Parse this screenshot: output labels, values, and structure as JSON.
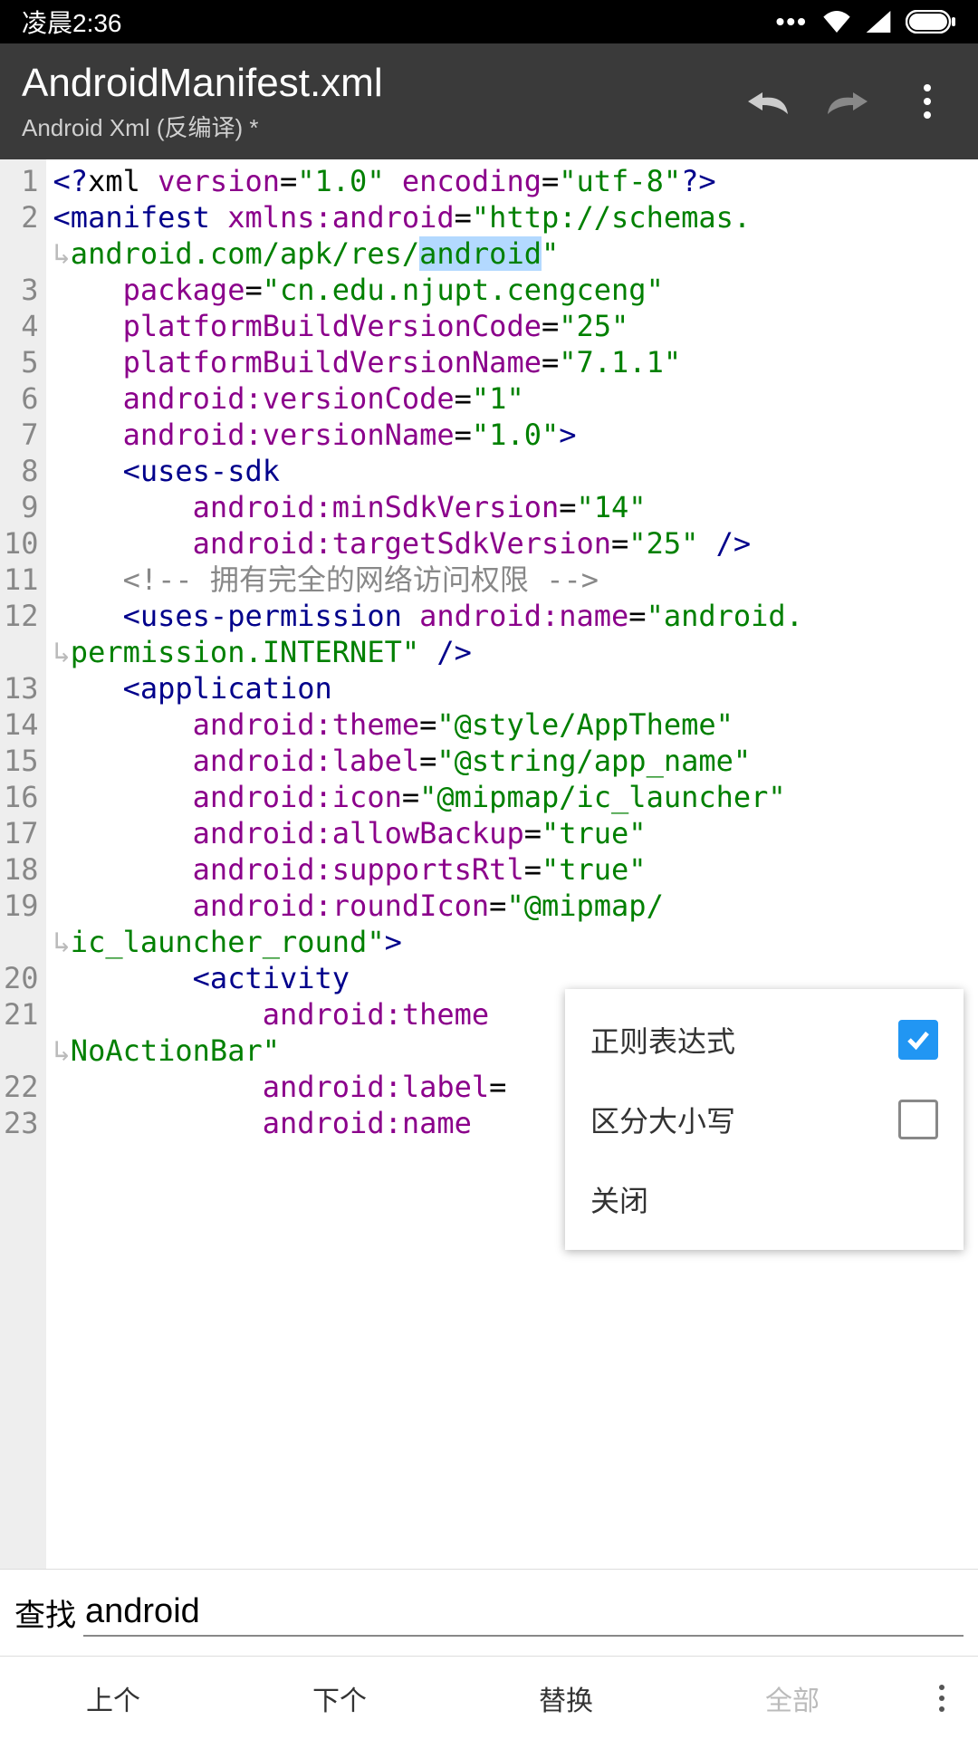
{
  "status": {
    "time": "凌晨2:36",
    "dots": "•••"
  },
  "appbar": {
    "title": "AndroidManifest.xml",
    "subtitle": "Android Xml (反编译) *"
  },
  "code": {
    "lines": [
      {
        "n": "1",
        "seg": [
          {
            "t": "<?",
            "c": "tag"
          },
          {
            "t": "xml ",
            "c": ""
          },
          {
            "t": "version",
            "c": "attr"
          },
          {
            "t": "=",
            "c": ""
          },
          {
            "t": "\"1.0\"",
            "c": "str"
          },
          {
            "t": " ",
            "c": ""
          },
          {
            "t": "encoding",
            "c": "attr"
          },
          {
            "t": "=",
            "c": ""
          },
          {
            "t": "\"utf-8\"",
            "c": "str"
          },
          {
            "t": "?>",
            "c": "tag"
          }
        ]
      },
      {
        "n": "2",
        "seg": [
          {
            "t": "<",
            "c": "tag"
          },
          {
            "t": "manifest ",
            "c": "tag"
          },
          {
            "t": "xmlns:android",
            "c": "ns"
          },
          {
            "t": "=",
            "c": ""
          },
          {
            "t": "\"http://schemas.",
            "c": "str"
          }
        ]
      },
      {
        "n": "",
        "wrap": true,
        "seg": [
          {
            "t": "↳",
            "c": "wrap-arrow"
          },
          {
            "t": "android.com/apk/res/",
            "c": "str"
          },
          {
            "t": "android",
            "c": "str",
            "sel": true
          },
          {
            "t": "\"",
            "c": "str"
          }
        ]
      },
      {
        "n": "3",
        "seg": [
          {
            "t": "    ",
            "c": ""
          },
          {
            "t": "package",
            "c": "attr"
          },
          {
            "t": "=",
            "c": ""
          },
          {
            "t": "\"cn.edu.njupt.cengceng\"",
            "c": "str"
          }
        ]
      },
      {
        "n": "4",
        "seg": [
          {
            "t": "    ",
            "c": ""
          },
          {
            "t": "platformBuildVersionCode",
            "c": "attr"
          },
          {
            "t": "=",
            "c": ""
          },
          {
            "t": "\"25\"",
            "c": "str"
          }
        ]
      },
      {
        "n": "5",
        "seg": [
          {
            "t": "    ",
            "c": ""
          },
          {
            "t": "platformBuildVersionName",
            "c": "attr"
          },
          {
            "t": "=",
            "c": ""
          },
          {
            "t": "\"7.1.1\"",
            "c": "str"
          }
        ]
      },
      {
        "n": "6",
        "seg": [
          {
            "t": "    ",
            "c": ""
          },
          {
            "t": "android:",
            "c": "ns"
          },
          {
            "t": "versionCode",
            "c": "attr"
          },
          {
            "t": "=",
            "c": ""
          },
          {
            "t": "\"1\"",
            "c": "str"
          }
        ]
      },
      {
        "n": "7",
        "seg": [
          {
            "t": "    ",
            "c": ""
          },
          {
            "t": "android:",
            "c": "ns"
          },
          {
            "t": "versionName",
            "c": "attr"
          },
          {
            "t": "=",
            "c": ""
          },
          {
            "t": "\"1.0\"",
            "c": "str"
          },
          {
            "t": ">",
            "c": "tag"
          }
        ]
      },
      {
        "n": "8",
        "seg": [
          {
            "t": "    ",
            "c": ""
          },
          {
            "t": "<",
            "c": "tag"
          },
          {
            "t": "uses-sdk",
            "c": "tag"
          }
        ]
      },
      {
        "n": "9",
        "seg": [
          {
            "t": "        ",
            "c": ""
          },
          {
            "t": "android:",
            "c": "ns"
          },
          {
            "t": "minSdkVersion",
            "c": "attr"
          },
          {
            "t": "=",
            "c": ""
          },
          {
            "t": "\"14\"",
            "c": "str"
          }
        ]
      },
      {
        "n": "10",
        "seg": [
          {
            "t": "        ",
            "c": ""
          },
          {
            "t": "android:",
            "c": "ns"
          },
          {
            "t": "targetSdkVersion",
            "c": "attr"
          },
          {
            "t": "=",
            "c": ""
          },
          {
            "t": "\"25\"",
            "c": "str"
          },
          {
            "t": " />",
            "c": "tag"
          }
        ]
      },
      {
        "n": "11",
        "seg": [
          {
            "t": "    ",
            "c": ""
          },
          {
            "t": "<!-- 拥有完全的网络访问权限 -->",
            "c": "cmt"
          }
        ]
      },
      {
        "n": "12",
        "seg": [
          {
            "t": "    ",
            "c": ""
          },
          {
            "t": "<",
            "c": "tag"
          },
          {
            "t": "uses-permission ",
            "c": "tag"
          },
          {
            "t": "android:",
            "c": "ns"
          },
          {
            "t": "name",
            "c": "attr"
          },
          {
            "t": "=",
            "c": ""
          },
          {
            "t": "\"android.",
            "c": "str"
          }
        ]
      },
      {
        "n": "",
        "wrap": true,
        "seg": [
          {
            "t": "↳",
            "c": "wrap-arrow"
          },
          {
            "t": "permission.INTERNET\"",
            "c": "str"
          },
          {
            "t": " />",
            "c": "tag"
          }
        ]
      },
      {
        "n": "13",
        "seg": [
          {
            "t": "    ",
            "c": ""
          },
          {
            "t": "<",
            "c": "tag"
          },
          {
            "t": "application",
            "c": "tag"
          }
        ]
      },
      {
        "n": "14",
        "seg": [
          {
            "t": "        ",
            "c": ""
          },
          {
            "t": "android:",
            "c": "ns"
          },
          {
            "t": "theme",
            "c": "attr"
          },
          {
            "t": "=",
            "c": ""
          },
          {
            "t": "\"@style/AppTheme\"",
            "c": "str"
          }
        ]
      },
      {
        "n": "15",
        "seg": [
          {
            "t": "        ",
            "c": ""
          },
          {
            "t": "android:",
            "c": "ns"
          },
          {
            "t": "label",
            "c": "attr"
          },
          {
            "t": "=",
            "c": ""
          },
          {
            "t": "\"@string/app_name\"",
            "c": "str"
          }
        ]
      },
      {
        "n": "16",
        "seg": [
          {
            "t": "        ",
            "c": ""
          },
          {
            "t": "android:",
            "c": "ns"
          },
          {
            "t": "icon",
            "c": "attr"
          },
          {
            "t": "=",
            "c": ""
          },
          {
            "t": "\"@mipmap/ic_launcher\"",
            "c": "str"
          }
        ]
      },
      {
        "n": "17",
        "seg": [
          {
            "t": "        ",
            "c": ""
          },
          {
            "t": "android:",
            "c": "ns"
          },
          {
            "t": "allowBackup",
            "c": "attr"
          },
          {
            "t": "=",
            "c": ""
          },
          {
            "t": "\"true\"",
            "c": "str"
          }
        ]
      },
      {
        "n": "18",
        "seg": [
          {
            "t": "        ",
            "c": ""
          },
          {
            "t": "android:",
            "c": "ns"
          },
          {
            "t": "supportsRtl",
            "c": "attr"
          },
          {
            "t": "=",
            "c": ""
          },
          {
            "t": "\"true\"",
            "c": "str"
          }
        ]
      },
      {
        "n": "19",
        "seg": [
          {
            "t": "        ",
            "c": ""
          },
          {
            "t": "android:",
            "c": "ns"
          },
          {
            "t": "roundIcon",
            "c": "attr"
          },
          {
            "t": "=",
            "c": ""
          },
          {
            "t": "\"@mipmap/",
            "c": "str"
          }
        ]
      },
      {
        "n": "",
        "wrap": true,
        "seg": [
          {
            "t": "↳",
            "c": "wrap-arrow"
          },
          {
            "t": "ic_launcher_round\"",
            "c": "str"
          },
          {
            "t": ">",
            "c": "tag"
          }
        ]
      },
      {
        "n": "20",
        "seg": [
          {
            "t": "        ",
            "c": ""
          },
          {
            "t": "<",
            "c": "tag"
          },
          {
            "t": "activity",
            "c": "tag"
          }
        ]
      },
      {
        "n": "21",
        "seg": [
          {
            "t": "            ",
            "c": ""
          },
          {
            "t": "android:",
            "c": "ns"
          },
          {
            "t": "theme",
            "c": "attr"
          }
        ]
      },
      {
        "n": "",
        "wrap": true,
        "seg": [
          {
            "t": "↳",
            "c": "wrap-arrow"
          },
          {
            "t": "NoActionBar\"",
            "c": "str"
          }
        ]
      },
      {
        "n": "22",
        "seg": [
          {
            "t": "            ",
            "c": ""
          },
          {
            "t": "android:",
            "c": "ns"
          },
          {
            "t": "label",
            "c": "attr"
          },
          {
            "t": "=",
            "c": ""
          }
        ]
      },
      {
        "n": "23",
        "seg": [
          {
            "t": "            ",
            "c": ""
          },
          {
            "t": "android:",
            "c": "ns"
          },
          {
            "t": "name",
            "c": "attr"
          }
        ]
      }
    ]
  },
  "popup": {
    "items": [
      {
        "label": "正则表达式",
        "checkbox": true,
        "checked": true
      },
      {
        "label": "区分大小写",
        "checkbox": true,
        "checked": false
      },
      {
        "label": "关闭",
        "checkbox": false
      }
    ]
  },
  "search": {
    "label": "查找",
    "value": "android"
  },
  "bottom": {
    "prev": "上个",
    "next": "下个",
    "replace": "替换",
    "all": "全部"
  }
}
